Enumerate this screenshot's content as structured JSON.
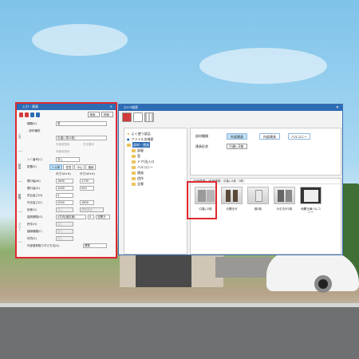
{
  "main_window": {
    "title": "ｺﾝﾃﾝﾂ検索",
    "close": "✕",
    "tree": [
      {
        "label": "よく使う部品",
        "icon": "star-icon"
      },
      {
        "label": "ファイル名検索",
        "icon": "search-icon"
      },
      {
        "label": "部材・建具",
        "icon": "folder-icon",
        "selected": true
      },
      {
        "label": "部屋",
        "icon": "folder-icon"
      },
      {
        "label": "窓",
        "icon": "folder-icon"
      },
      {
        "label": "ドア/出入口",
        "icon": "folder-icon"
      },
      {
        "label": "バルコニー",
        "icon": "folder-icon"
      },
      {
        "label": "建具",
        "icon": "folder-icon"
      },
      {
        "label": "造作",
        "icon": "folder-icon"
      },
      {
        "label": "全景",
        "icon": "folder-icon"
      }
    ],
    "attributes": {
      "type_label": "部材種類",
      "type_options": [
        "外部建具",
        "内部建具",
        "バルコニー"
      ],
      "shape_label": "建具形状",
      "shape_value": "引違い2枚"
    },
    "results_header": "[内部建具]（外部建具）引違い2枚（3件）",
    "thumbnails": [
      {
        "caption": "引違い2枚",
        "selected": true
      },
      {
        "caption": "片開き戸"
      },
      {
        "caption": "襖2枚"
      },
      {
        "caption": "片引き戸2枚"
      },
      {
        "caption": "両開き扉バルコニー"
      }
    ]
  },
  "panel": {
    "title": "入力 - 建具",
    "close": "✕",
    "search_label": "検索..",
    "detail_label": "詳細..",
    "vtabs": [
      "入力",
      "部品",
      "建物",
      "ツリー"
    ],
    "fields": {
      "kind_label": "種類(K)",
      "kind_value": "窓",
      "subtype_label": "- 部材種別",
      "subtype_value": "引違い窓(2枚)",
      "check1": "外部用窓枠",
      "check2": "左手勝手",
      "check3": "内部用窓枠",
      "code_label": "ｺｰﾄﾞ番号(C)",
      "code_value": "なし",
      "place_label": "配置(E)",
      "tabs": [
        "1 カ所",
        "任意",
        "中心",
        "連続"
      ],
      "col1": "内寸(W×H)",
      "col2": "外寸(W×H)",
      "width_label": "開口幅(W)",
      "width_value": "1690",
      "width_value2": "1730",
      "height_label": "開口高(H)",
      "height_value": "1000",
      "height_value2": "900",
      "sill_label": "窓台高さ(D)",
      "sill_value": "0",
      "head_label": "内法高さ(E)",
      "head_value": "2000",
      "head_value2": "1800",
      "step_label": "段差(S)",
      "step_value": "なし",
      "dir_label": "開き方向(R)",
      "dir_value": "右開き",
      "std_label": "標準設定",
      "open_label": "建具開閉(O)",
      "open_value": "4方向(固定無)",
      "open_value2": "0",
      "handle_label": "把手(H)",
      "handle_value": "なし",
      "frame_label": "額縁種類(F)",
      "frame_value": "なし",
      "mat_label": "材質(E)",
      "mat_value": "なし",
      "install_label": "外部建具取り付け方法(A)",
      "install_value": "標準"
    }
  }
}
